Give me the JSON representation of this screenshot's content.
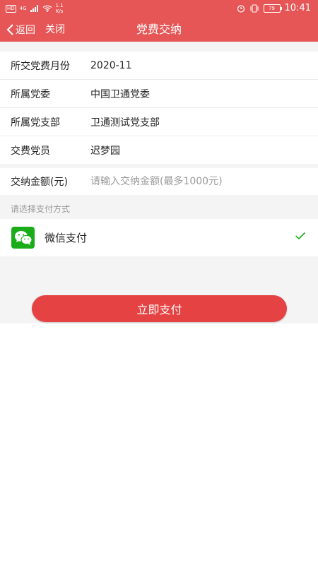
{
  "status_bar": {
    "hd": "HD",
    "network": "4G",
    "speed_value": "1.1",
    "speed_unit": "K/s",
    "battery": "79",
    "time": "10:41"
  },
  "nav": {
    "back_label": "返回",
    "close_label": "关闭",
    "title": "党费交纳"
  },
  "info": [
    {
      "label": "所交党费月份",
      "value": "2020-11"
    },
    {
      "label": "所属党委",
      "value": "中国卫通党委"
    },
    {
      "label": "所属党支部",
      "value": "卫通测试党支部"
    },
    {
      "label": "交费党员",
      "value": "迟梦园"
    }
  ],
  "amount": {
    "label": "交纳金额(元)",
    "placeholder": "请输入交纳金额(最多1000元)",
    "value": ""
  },
  "payment": {
    "section_title": "请选择支付方式",
    "method": "微信支付",
    "selected": true
  },
  "submit_label": "立即支付",
  "colors": {
    "primary": "#e65657",
    "button": "#e54343",
    "wechat": "#1aad19",
    "check": "#1aad19"
  }
}
